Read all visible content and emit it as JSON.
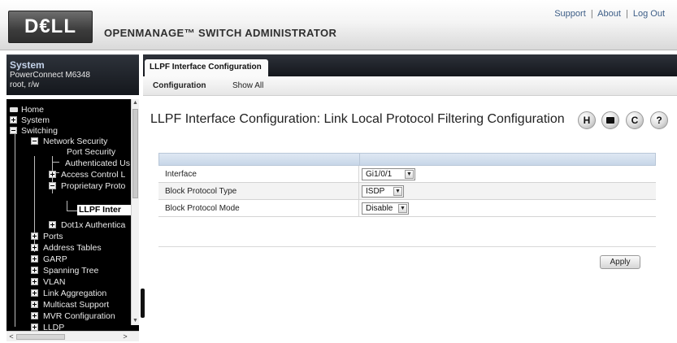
{
  "header": {
    "logo_text": "D€LL",
    "app_title": "OPENMANAGE™ SWITCH ADMINISTRATOR",
    "links": [
      "Support",
      "About",
      "Log Out"
    ],
    "link_separator": "|"
  },
  "system_panel": {
    "title": "System",
    "model": "PowerConnect M6348",
    "user": "root, r/w"
  },
  "nav_tree": {
    "items": [
      {
        "label": "Home",
        "icon": "home-icon"
      },
      {
        "label": "System",
        "icon": "expand-plus-icon"
      },
      {
        "label": "Switching",
        "icon": "collapse-minus-icon"
      },
      {
        "label": "Network Security",
        "icon": "collapse-minus-icon"
      },
      {
        "label": "Port Security",
        "icon": ""
      },
      {
        "label": "Authenticated Us",
        "icon": ""
      },
      {
        "label": "Access Control L",
        "icon": "expand-plus-icon"
      },
      {
        "label": "Proprietary Proto",
        "icon": "collapse-minus-icon"
      },
      {
        "label": "LLPF Inter",
        "icon": ""
      },
      {
        "label": "Dot1x Authentica",
        "icon": "expand-plus-icon"
      },
      {
        "label": "Ports",
        "icon": "expand-plus-icon"
      },
      {
        "label": "Address Tables",
        "icon": "expand-plus-icon"
      },
      {
        "label": "GARP",
        "icon": "expand-plus-icon"
      },
      {
        "label": "Spanning Tree",
        "icon": "expand-plus-icon"
      },
      {
        "label": "VLAN",
        "icon": "expand-plus-icon"
      },
      {
        "label": "Link Aggregation",
        "icon": "expand-plus-icon"
      },
      {
        "label": "Multicast Support",
        "icon": "expand-plus-icon"
      },
      {
        "label": "MVR Configuration",
        "icon": "expand-plus-icon"
      },
      {
        "label": "LLDP",
        "icon": "expand-plus-icon"
      }
    ],
    "selected": "LLPF Inter"
  },
  "tabs": {
    "active": "LLPF Interface Configuration",
    "subtabs": [
      "Configuration",
      "Show All"
    ]
  },
  "page": {
    "title": "LLPF Interface Configuration: Link Local Protocol Filtering Configuration",
    "toolbar_icons": [
      "save-icon",
      "print-icon",
      "refresh-icon",
      "help-icon"
    ],
    "toolbar_glyphs": {
      "save": "H",
      "refresh": "C",
      "help": "?"
    }
  },
  "form": {
    "rows": [
      {
        "label": "Interface",
        "value": "Gi1/0/1"
      },
      {
        "label": "Block Protocol Type",
        "value": "ISDP"
      },
      {
        "label": "Block Protocol Mode",
        "value": "Disable"
      }
    ],
    "apply_label": "Apply"
  },
  "colors": {
    "nav_background": "#000000",
    "panel_header": "#1e2228",
    "table_header": "#c7d6e8",
    "system_title": "#c4d3ea"
  }
}
